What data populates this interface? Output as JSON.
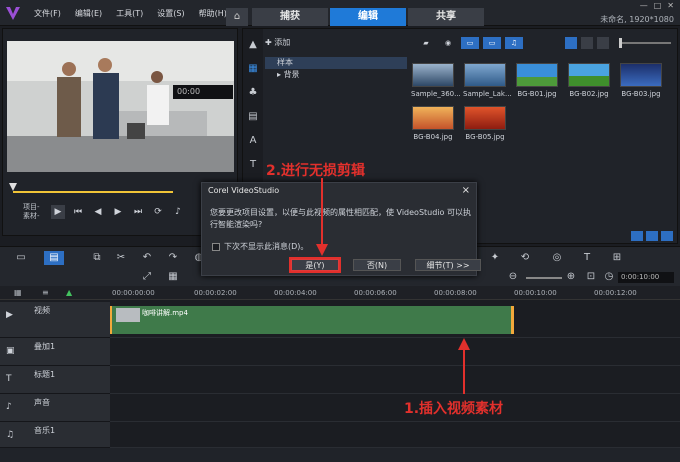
{
  "app": {
    "menu": [
      "文件(F)",
      "编辑(E)",
      "工具(T)",
      "设置(S)",
      "帮助(H)"
    ],
    "tabs": [
      "捕获",
      "编辑",
      "共享"
    ],
    "active_tab": "编辑",
    "project_info": "未命名, 1920*1080",
    "brand_color": "#1f7ad8"
  },
  "preview": {
    "project_label": "项目-",
    "clip_label": "素材-",
    "timecode": "00:00"
  },
  "library": {
    "add_label": "添加",
    "folders": [
      "样本",
      "背景"
    ],
    "active_folder": "样本",
    "thumbnails": [
      {
        "label": "Sample_360...",
        "color": "#5b7fa8"
      },
      {
        "label": "Sample_Lak...",
        "color": "#3f6fa0"
      },
      {
        "label": "BG-B01.jpg",
        "color": "#3a8fd9"
      },
      {
        "label": "BG-B02.jpg",
        "color": "#4aa3e0"
      },
      {
        "label": "BG-B03.jpg",
        "color": "#3b6cc0"
      },
      {
        "label": "BG-B04.jpg",
        "color": "#d8763a"
      },
      {
        "label": "BG-B05.jpg",
        "color": "#c0321e"
      }
    ]
  },
  "timeline": {
    "ruler": [
      "00:00:00:00",
      "00:00:02:00",
      "00:00:04:00",
      "00:00:06:00",
      "00:00:08:00",
      "00:00:10:00",
      "00:00:12:00"
    ],
    "zoom_time": "0:00:10:00",
    "tracks": [
      {
        "name": "视频",
        "icon": "▶"
      },
      {
        "name": "叠加1",
        "icon": "▣"
      },
      {
        "name": "标题1",
        "icon": "T"
      },
      {
        "name": "声音",
        "icon": "♪"
      },
      {
        "name": "音乐1",
        "icon": "♫"
      }
    ],
    "clip_name": "咖啡讲解.mp4"
  },
  "dialog": {
    "title": "Corel VideoStudio",
    "message": "您要更改项目设置，以便与此视频的属性相匹配，使 VideoStudio 可以执行智能渲染吗?",
    "checkbox": "下次不显示此消息(D)。",
    "yes": "是(Y)",
    "no": "否(N)",
    "details": "细节(T) >>"
  },
  "annotations": {
    "step1": "1.插入视频素材",
    "step2": "2.进行无损剪辑",
    "color": "#e2302c"
  }
}
